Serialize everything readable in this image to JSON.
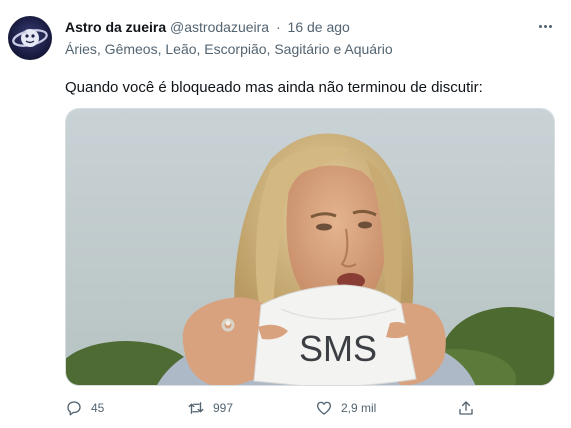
{
  "tweet": {
    "display_name": "Astro da zueira",
    "handle": "@astrodazueira",
    "separator": "·",
    "timestamp": "16 de ago",
    "signs_line": "Áries, Gêmeos, Leão, Escorpião, Sagitário e Aquário",
    "text": "Quando você é bloqueado mas ainda não terminou de discutir:",
    "image_caption": "SMS"
  },
  "actions": {
    "replies": "45",
    "retweets": "997",
    "likes": "2,9 mil"
  },
  "icons": [
    "more-options-icon",
    "reply-icon",
    "retweet-icon",
    "like-icon",
    "share-icon"
  ],
  "colors": {
    "text_primary": "#0f1419",
    "text_secondary": "#536471",
    "avatar_bg": "#1c1f45"
  }
}
